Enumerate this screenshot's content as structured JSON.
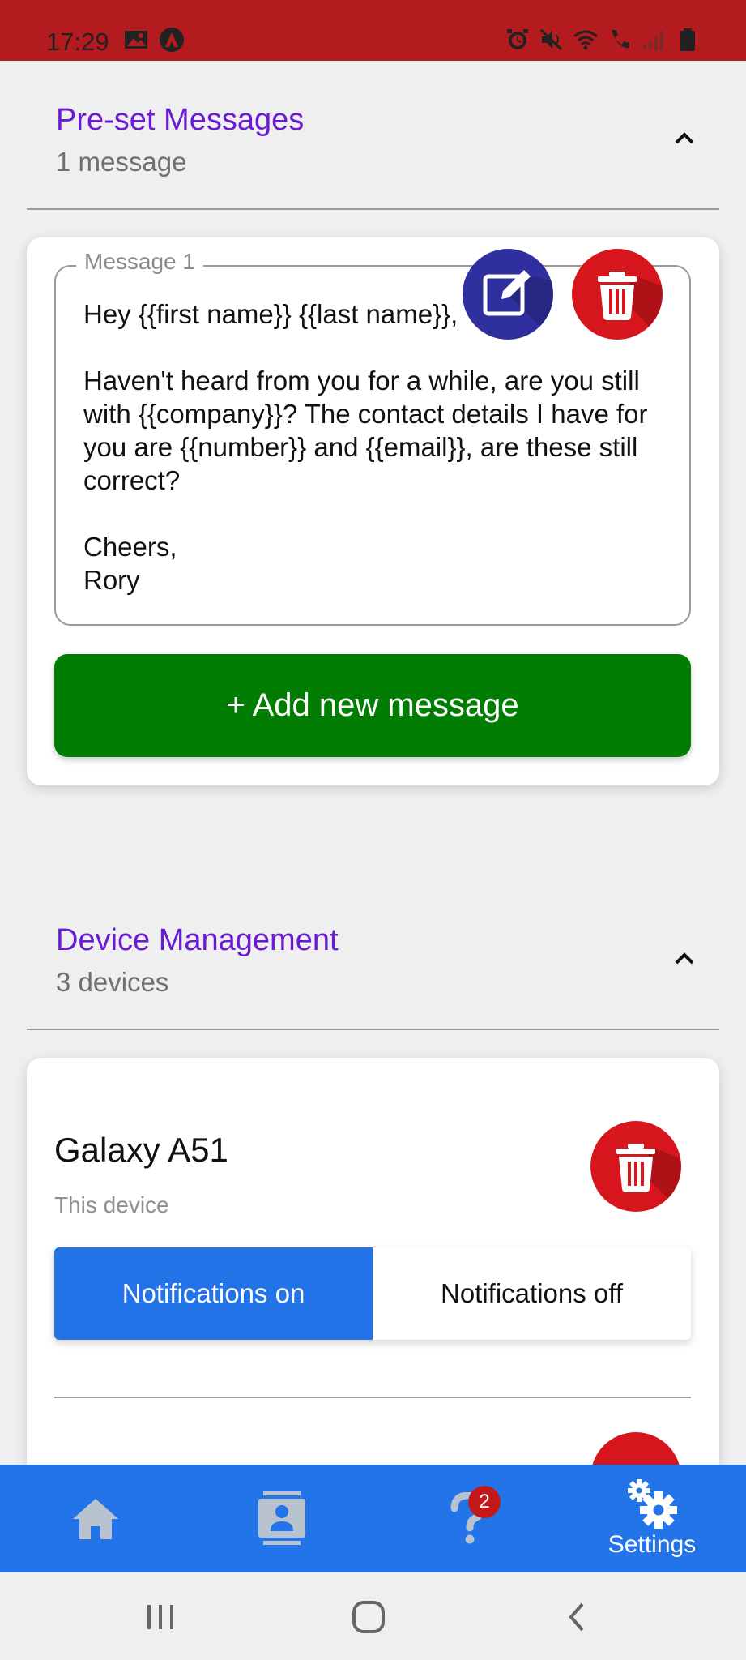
{
  "status_bar": {
    "time": "17:29"
  },
  "preset_section": {
    "title": "Pre-set Messages",
    "subtitle": "1 message",
    "message": {
      "label": "Message 1",
      "text": "Hey {{first name}} {{last name}},\n\nHaven't heard from you for a while, are you still with {{company}}? The contact details I have for you are {{number}} and {{email}}, are these still correct?\n\nCheers,\nRory"
    },
    "add_button_label": "+ Add new message"
  },
  "device_section": {
    "title": "Device Management",
    "subtitle": "3 devices",
    "devices": [
      {
        "name": "Galaxy A51",
        "subtitle": "This device",
        "notifications_on_label": "Notifications on",
        "notifications_off_label": "Notifications off",
        "selected": "on"
      }
    ]
  },
  "bottom_nav": {
    "items": [
      {
        "id": "home",
        "icon": "home-icon",
        "label": ""
      },
      {
        "id": "contacts",
        "icon": "contact-card-icon",
        "label": ""
      },
      {
        "id": "help",
        "icon": "question-icon",
        "label": "",
        "badge": "2"
      },
      {
        "id": "settings",
        "icon": "gear-icon",
        "label": "Settings",
        "active": true
      }
    ]
  },
  "colors": {
    "status_bar": "#b31b1e",
    "accent_purple": "#6a1bd6",
    "primary_blue": "#2374e9",
    "add_green": "#027d04",
    "delete_red": "#d6161c",
    "edit_indigo": "#2f2fa0"
  }
}
